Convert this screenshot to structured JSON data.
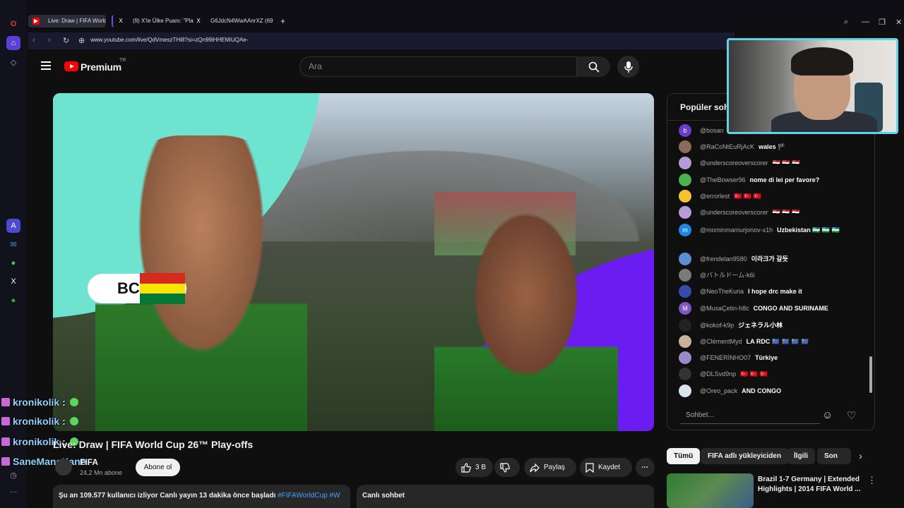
{
  "browser": {
    "tabs": [
      {
        "label": "Live: Draw | FIFA World",
        "favicon": "youtube-icon"
      },
      {
        "label": "(9) X'te Ülke Puanı: \"Play-(",
        "favicon": "x-icon"
      },
      {
        "label": "G6JdcN4WwAAnrXZ (691",
        "favicon": "x-icon"
      }
    ],
    "url": "www.youtube.com/live/QdVmeszTHi8?si=zQn99iHHEMiUQAe-"
  },
  "youtube": {
    "brand": "Premium",
    "region": "TR",
    "search_placeholder": "Ara"
  },
  "video": {
    "overlay_text": "BC",
    "title": "Live: Draw | FIFA World Cup 26™ Play-offs",
    "channel": "FIFA",
    "subscribers": "24,2 Mn abone",
    "subscribe_label": "Abone ol",
    "likes": "3 B",
    "share_label": "Paylaş",
    "save_label": "Kaydet",
    "description_stats": "Şu an 109.577 kullanıcı izliyor  Canlı yayın 13 dakika önce başladı",
    "description_tag": "#FIFAWorldCup #W",
    "live_chat_label": "Canlı sohbet"
  },
  "chat": {
    "header": "Popüler sohbet",
    "input_placeholder": "Sohbet...",
    "messages": [
      {
        "user": "@bosan",
        "text": "",
        "avatar": "b",
        "color": "#6a3cc9"
      },
      {
        "user": "@RaCoNtEuRjAcK",
        "text": "wales 🏴",
        "avatar": "",
        "color": "#8a6a5a"
      },
      {
        "user": "@underscoreoverscorer",
        "text": "🇪🇬 🇪🇬 🇪🇬",
        "avatar": "",
        "color": "#b79ad6"
      },
      {
        "user": "@TheBowser96",
        "text": "nome di lei per favore?",
        "avatar": "",
        "color": "#4caf50"
      },
      {
        "user": "@errorlest",
        "text": "🇹🇷 🇹🇷 🇹🇷",
        "avatar": "",
        "color": "#f4c430"
      },
      {
        "user": "@underscoreoverscorer",
        "text": "🇪🇬 🇪🇬 🇪🇬",
        "avatar": "",
        "color": "#b79ad6"
      },
      {
        "user": "@mominmamurjonov-x1h",
        "text": "Uzbekistan 🇺🇿 🇺🇿 🇺🇿",
        "avatar": "m",
        "color": "#1e88e5"
      },
      {
        "user": "@frendelan9580",
        "text": "이라크가 갈듯",
        "avatar": "",
        "color": "#5a8fd6"
      },
      {
        "user": "@バトルドーム-k6i",
        "text": "",
        "avatar": "",
        "color": "#7a7a7a"
      },
      {
        "user": "@NeoTheKuria",
        "text": "I hope drc make it",
        "avatar": "",
        "color": "#3949ab"
      },
      {
        "user": "@MusaÇetin-h8c",
        "text": "CONGO AND SURINAME",
        "avatar": "M",
        "color": "#7e57c2"
      },
      {
        "user": "@kokof-k9p",
        "text": "ジェネラル小林",
        "avatar": "",
        "color": "#222222"
      },
      {
        "user": "@ClémentMyd",
        "text": "LA RDC 🇨🇩 🇨🇩 🇨🇩 🇨🇩",
        "avatar": "",
        "color": "#c9b29a"
      },
      {
        "user": "@FENERİNHO07",
        "text": "Türkiye",
        "avatar": "",
        "color": "#9a8ac9"
      },
      {
        "user": "@DLSvd9np",
        "text": "🇹🇷 🇹🇷 🇹🇷",
        "avatar": "",
        "color": "#333333"
      },
      {
        "user": "@Oreo_pack",
        "text": "AND CONGO",
        "avatar": "",
        "color": "#d8e4f0"
      }
    ]
  },
  "recommendations": {
    "chips": [
      "Tümü",
      "FIFA adlı yükleyiciden",
      "İlgili",
      "Son yü"
    ],
    "item": {
      "title": "Brazil 1-7 Germany | Extended Highlights | 2014 FIFA World ..."
    }
  },
  "twitch_chat": [
    {
      "name": "kronikolik",
      "sep": ":"
    },
    {
      "name": "kronikolik",
      "sep": ":"
    },
    {
      "name": "kronikolik",
      "sep": ":"
    },
    {
      "name": "SaneManeKane",
      "sep": ""
    }
  ]
}
